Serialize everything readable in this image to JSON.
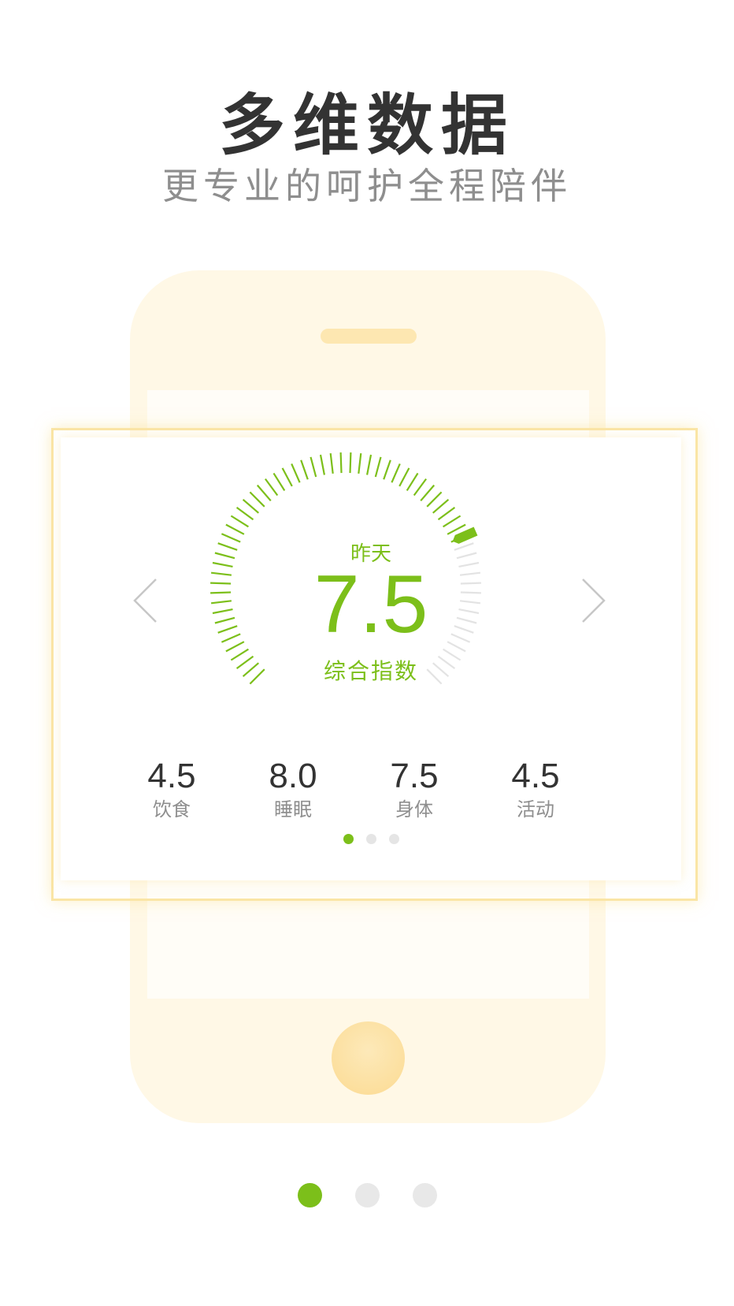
{
  "intro": {
    "title": "多维数据",
    "subtitle": "更专业的呵护全程陪伴"
  },
  "gauge": {
    "period_label": "昨天",
    "score": "7.5",
    "score_label": "综合指数",
    "score_fraction": 0.75,
    "colors": {
      "active": "#7cbf1a",
      "inactive": "#e3e3e3"
    }
  },
  "nav": {
    "prev_icon": "chevron-left-icon",
    "next_icon": "chevron-right-icon"
  },
  "metrics": [
    {
      "value": "4.5",
      "label": "饮食"
    },
    {
      "value": "8.0",
      "label": "睡眠"
    },
    {
      "value": "7.5",
      "label": "身体"
    },
    {
      "value": "4.5",
      "label": "活动"
    }
  ],
  "card_pager": {
    "count": 3,
    "active_index": 0
  },
  "page_pager": {
    "count": 3,
    "active_index": 0
  },
  "theme": {
    "accent": "#7cbf1a",
    "phone_fill": "#fff8e6",
    "card_border": "#fae5a6"
  }
}
